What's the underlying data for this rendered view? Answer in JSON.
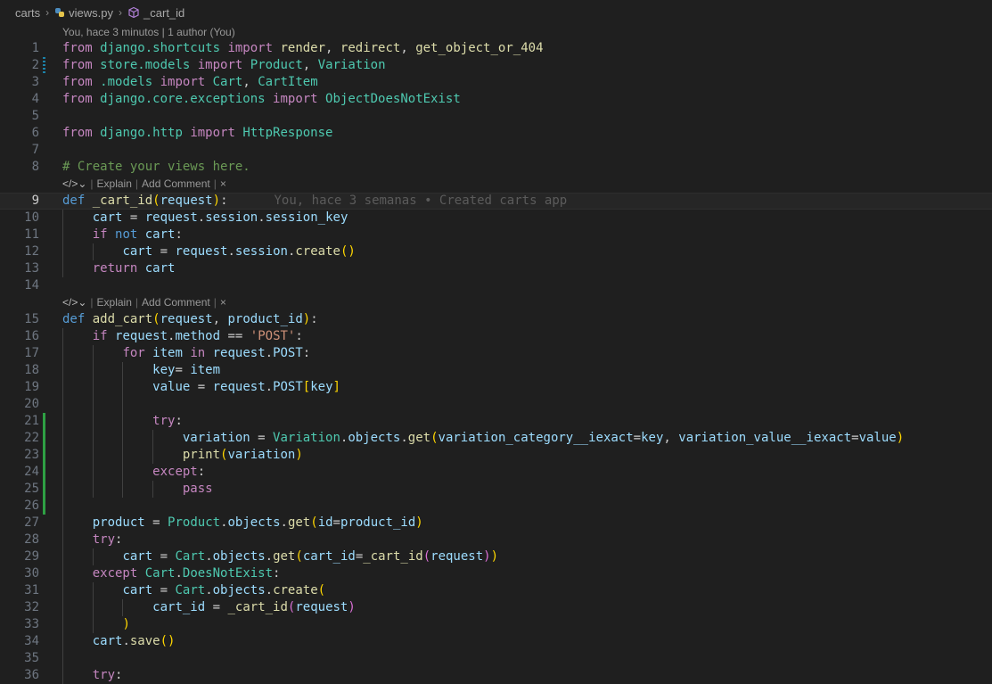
{
  "breadcrumb": {
    "folder": "carts",
    "file": "views.py",
    "symbol": "_cart_id"
  },
  "blame": {
    "header": "You, hace 3 minutos | 1 author (You)",
    "inline": "You, hace 3 semanas • Created carts app"
  },
  "codelens": {
    "explain": "Explain",
    "add_comment": "Add Comment",
    "close": "×"
  },
  "cursor_line": 9,
  "lines": [
    {
      "n": "1",
      "html": "<span class='kw'>from</span> <span class='mod'>django.shortcuts</span> <span class='kw'>import</span> <span class='fn'>render</span><span class='pl'>, </span><span class='fn'>redirect</span><span class='pl'>, </span><span class='fn'>get_object_or_404</span>"
    },
    {
      "n": "2",
      "html": "<span class='kw'>from</span> <span class='mod'>store.models</span> <span class='kw'>import</span> <span class='cls'>Product</span><span class='pl'>, </span><span class='cls'>Variation</span>",
      "gutter": "mod"
    },
    {
      "n": "3",
      "html": "<span class='kw'>from</span> <span class='mod'>.models</span> <span class='kw'>import</span> <span class='cls'>Cart</span><span class='pl'>, </span><span class='cls'>CartItem</span>"
    },
    {
      "n": "4",
      "html": "<span class='kw'>from</span> <span class='mod'>django.core.exceptions</span> <span class='kw'>import</span> <span class='cls'>ObjectDoesNotExist</span>"
    },
    {
      "n": "5",
      "html": ""
    },
    {
      "n": "6",
      "html": "<span class='kw'>from</span> <span class='mod'>django.http</span> <span class='kw'>import</span> <span class='cls'>HttpResponse</span>"
    },
    {
      "n": "7",
      "html": ""
    },
    {
      "n": "8",
      "html": "<span class='cmt'># Create your views here.</span>"
    },
    {
      "lens": true
    },
    {
      "n": "9",
      "html": "<span class='kw2'>def</span> <span class='fn'>_cart_id</span><span class='p1'>(</span><span class='var'>request</span><span class='p1'>)</span><span class='pl'>:</span>",
      "cursor": true,
      "ghost": true
    },
    {
      "n": "10",
      "html": "    <span class='var'>cart</span> <span class='pl'>=</span> <span class='var'>request</span><span class='pl'>.</span><span class='var'>session</span><span class='pl'>.</span><span class='var'>session_key</span>",
      "guides": [
        1
      ]
    },
    {
      "n": "11",
      "html": "    <span class='kw'>if</span> <span class='kw2'>not</span> <span class='var'>cart</span><span class='pl'>:</span>",
      "guides": [
        1
      ]
    },
    {
      "n": "12",
      "html": "        <span class='var'>cart</span> <span class='pl'>=</span> <span class='var'>request</span><span class='pl'>.</span><span class='var'>session</span><span class='pl'>.</span><span class='fn'>create</span><span class='p1'>()</span>",
      "guides": [
        1,
        2
      ]
    },
    {
      "n": "13",
      "html": "    <span class='kw'>return</span> <span class='var'>cart</span>",
      "guides": [
        1
      ]
    },
    {
      "n": "14",
      "html": ""
    },
    {
      "lens": true
    },
    {
      "n": "15",
      "html": "<span class='kw2'>def</span> <span class='fn'>add_cart</span><span class='p1'>(</span><span class='var'>request</span><span class='pl'>, </span><span class='var'>product_id</span><span class='p1'>)</span><span class='pl'>:</span>"
    },
    {
      "n": "16",
      "html": "    <span class='kw'>if</span> <span class='var'>request</span><span class='pl'>.</span><span class='var'>method</span> <span class='pl'>==</span> <span class='str'>'POST'</span><span class='pl'>:</span>",
      "guides": [
        1
      ]
    },
    {
      "n": "17",
      "html": "        <span class='kw'>for</span> <span class='var'>item</span> <span class='kw'>in</span> <span class='var'>request</span><span class='pl'>.</span><span class='var'>POST</span><span class='pl'>:</span>",
      "guides": [
        1,
        2
      ]
    },
    {
      "n": "18",
      "html": "            <span class='var'>key</span><span class='pl'>=</span> <span class='var'>item</span>",
      "guides": [
        1,
        2,
        3
      ]
    },
    {
      "n": "19",
      "html": "            <span class='var'>value</span> <span class='pl'>=</span> <span class='var'>request</span><span class='pl'>.</span><span class='var'>POST</span><span class='p1'>[</span><span class='var'>key</span><span class='p1'>]</span>",
      "guides": [
        1,
        2,
        3
      ]
    },
    {
      "n": "20",
      "html": "",
      "guides": [
        1,
        2,
        3
      ]
    },
    {
      "n": "21",
      "html": "            <span class='kw'>try</span><span class='pl'>:</span>",
      "guides": [
        1,
        2,
        3
      ],
      "gutter": "add"
    },
    {
      "n": "22",
      "html": "                <span class='var'>variation</span> <span class='pl'>=</span> <span class='cls'>Variation</span><span class='pl'>.</span><span class='var'>objects</span><span class='pl'>.</span><span class='fn'>get</span><span class='p1'>(</span><span class='var'>variation_category__iexact</span><span class='pl'>=</span><span class='var'>key</span><span class='pl'>, </span><span class='var'>variation_value__iexact</span><span class='pl'>=</span><span class='var'>value</span><span class='p1'>)</span>",
      "guides": [
        1,
        2,
        3,
        4
      ],
      "gutter": "add"
    },
    {
      "n": "23",
      "html": "                <span class='fn'>print</span><span class='p1'>(</span><span class='var'>variation</span><span class='p1'>)</span>",
      "guides": [
        1,
        2,
        3,
        4
      ],
      "gutter": "add"
    },
    {
      "n": "24",
      "html": "            <span class='kw'>except</span><span class='pl'>:</span>",
      "guides": [
        1,
        2,
        3
      ],
      "gutter": "add"
    },
    {
      "n": "25",
      "html": "                <span class='kw'>pass</span>",
      "guides": [
        1,
        2,
        3,
        4
      ],
      "gutter": "add"
    },
    {
      "n": "26",
      "html": "",
      "guides": [
        1
      ],
      "gutter": "add"
    },
    {
      "n": "27",
      "html": "    <span class='var'>product</span> <span class='pl'>=</span> <span class='cls'>Product</span><span class='pl'>.</span><span class='var'>objects</span><span class='pl'>.</span><span class='fn'>get</span><span class='p1'>(</span><span class='var'>id</span><span class='pl'>=</span><span class='var'>product_id</span><span class='p1'>)</span>",
      "guides": [
        1
      ]
    },
    {
      "n": "28",
      "html": "    <span class='kw'>try</span><span class='pl'>:</span>",
      "guides": [
        1
      ]
    },
    {
      "n": "29",
      "html": "        <span class='var'>cart</span> <span class='pl'>=</span> <span class='cls'>Cart</span><span class='pl'>.</span><span class='var'>objects</span><span class='pl'>.</span><span class='fn'>get</span><span class='p1'>(</span><span class='var'>cart_id</span><span class='pl'>=</span><span class='fn'>_cart_id</span><span class='p2'>(</span><span class='var'>request</span><span class='p2'>)</span><span class='p1'>)</span>",
      "guides": [
        1,
        2
      ]
    },
    {
      "n": "30",
      "html": "    <span class='kw'>except</span> <span class='cls'>Cart</span><span class='pl'>.</span><span class='cls'>DoesNotExist</span><span class='pl'>:</span>",
      "guides": [
        1
      ]
    },
    {
      "n": "31",
      "html": "        <span class='var'>cart</span> <span class='pl'>=</span> <span class='cls'>Cart</span><span class='pl'>.</span><span class='var'>objects</span><span class='pl'>.</span><span class='fn'>create</span><span class='p1'>(</span>",
      "guides": [
        1,
        2
      ]
    },
    {
      "n": "32",
      "html": "            <span class='var'>cart_id</span> <span class='pl'>=</span> <span class='fn'>_cart_id</span><span class='p2'>(</span><span class='var'>request</span><span class='p2'>)</span>",
      "guides": [
        1,
        2,
        3
      ]
    },
    {
      "n": "33",
      "html": "        <span class='p1'>)</span>",
      "guides": [
        1,
        2
      ]
    },
    {
      "n": "34",
      "html": "    <span class='var'>cart</span><span class='pl'>.</span><span class='fn'>save</span><span class='p1'>()</span>",
      "guides": [
        1
      ]
    },
    {
      "n": "35",
      "html": "",
      "guides": [
        1
      ]
    },
    {
      "n": "36",
      "html": "    <span class='kw'>try</span><span class='pl'>:</span>",
      "guides": [
        1
      ]
    }
  ]
}
